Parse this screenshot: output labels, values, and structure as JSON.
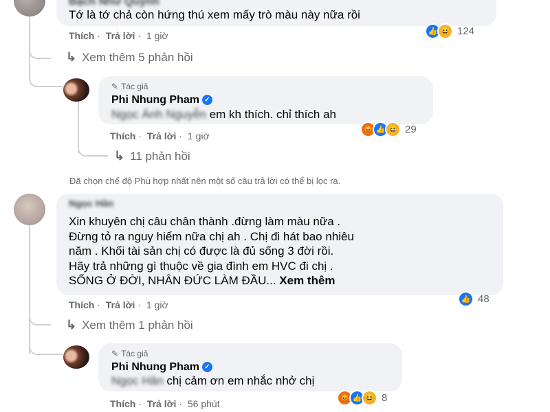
{
  "comment1": {
    "author": "Bạch Như Quỳnh",
    "text": "Tớ là tớ chả còn hứng thú xem mấy trò màu này nữa rồi",
    "like_label": "Thích",
    "reply_label": "Trả lời",
    "time": "1 giờ",
    "reaction_count": "124",
    "view_more": "Xem thêm 5 phản hồi"
  },
  "reply1": {
    "author_tag": "Tác giả",
    "author": "Phi Nhung Pham",
    "mention": "Ngọc Ánh Nguyễn",
    "text": "em kh thích. chỉ thích ah",
    "like_label": "Thích",
    "reply_label": "Trả lời",
    "time": "1 giờ",
    "reaction_count": "29",
    "replies_label": "11 phản hồi"
  },
  "filter_notice": "Đã chọn chế độ Phù hợp nhất nên một số câu trả lời có thể bị lọc ra.",
  "comment2": {
    "author": "Ngọc Hân",
    "lines": [
      "Xin khuyên chị câu chân thành .đừng làm màu nữa .",
      "Đừng tỏ ra nguy hiểm nữa chị ah . Chị đi hát bao nhiêu",
      "năm . Khối tài sản chị có được là đủ sống 3 đời rồi.",
      "Hãy trả những gì thuộc về gia đình em HVC đi chị .",
      "SỐNG Ở ĐỜI, NHÂN ĐỨC LÀM ĐẦU..."
    ],
    "see_more": "Xem thêm",
    "like_label": "Thích",
    "reply_label": "Trả lời",
    "time": "1 giờ",
    "reaction_count": "48",
    "view_more": "Xem thêm 1 phản hồi"
  },
  "reply2": {
    "author_tag": "Tác giả",
    "author": "Phi Nhung Pham",
    "mention": "Ngọc Hân",
    "text": "chị cảm ơn em nhắc nhở chị",
    "like_label": "Thích",
    "reply_label": "Trả lời",
    "time": "56 phút",
    "reaction_count": "8"
  },
  "icons": {
    "like": "like-reaction-icon",
    "haha": "haha-reaction-icon",
    "angry": "angry-reaction-icon",
    "verified": "verified-badge-icon",
    "pencil": "pencil-icon",
    "reply_arrow": "reply-arrow-icon"
  },
  "colors": {
    "bubble": "#f0f2f5",
    "meta": "#65676b",
    "like": "#1877f2",
    "haha": "#f7b125",
    "angry": "#e9710f"
  }
}
